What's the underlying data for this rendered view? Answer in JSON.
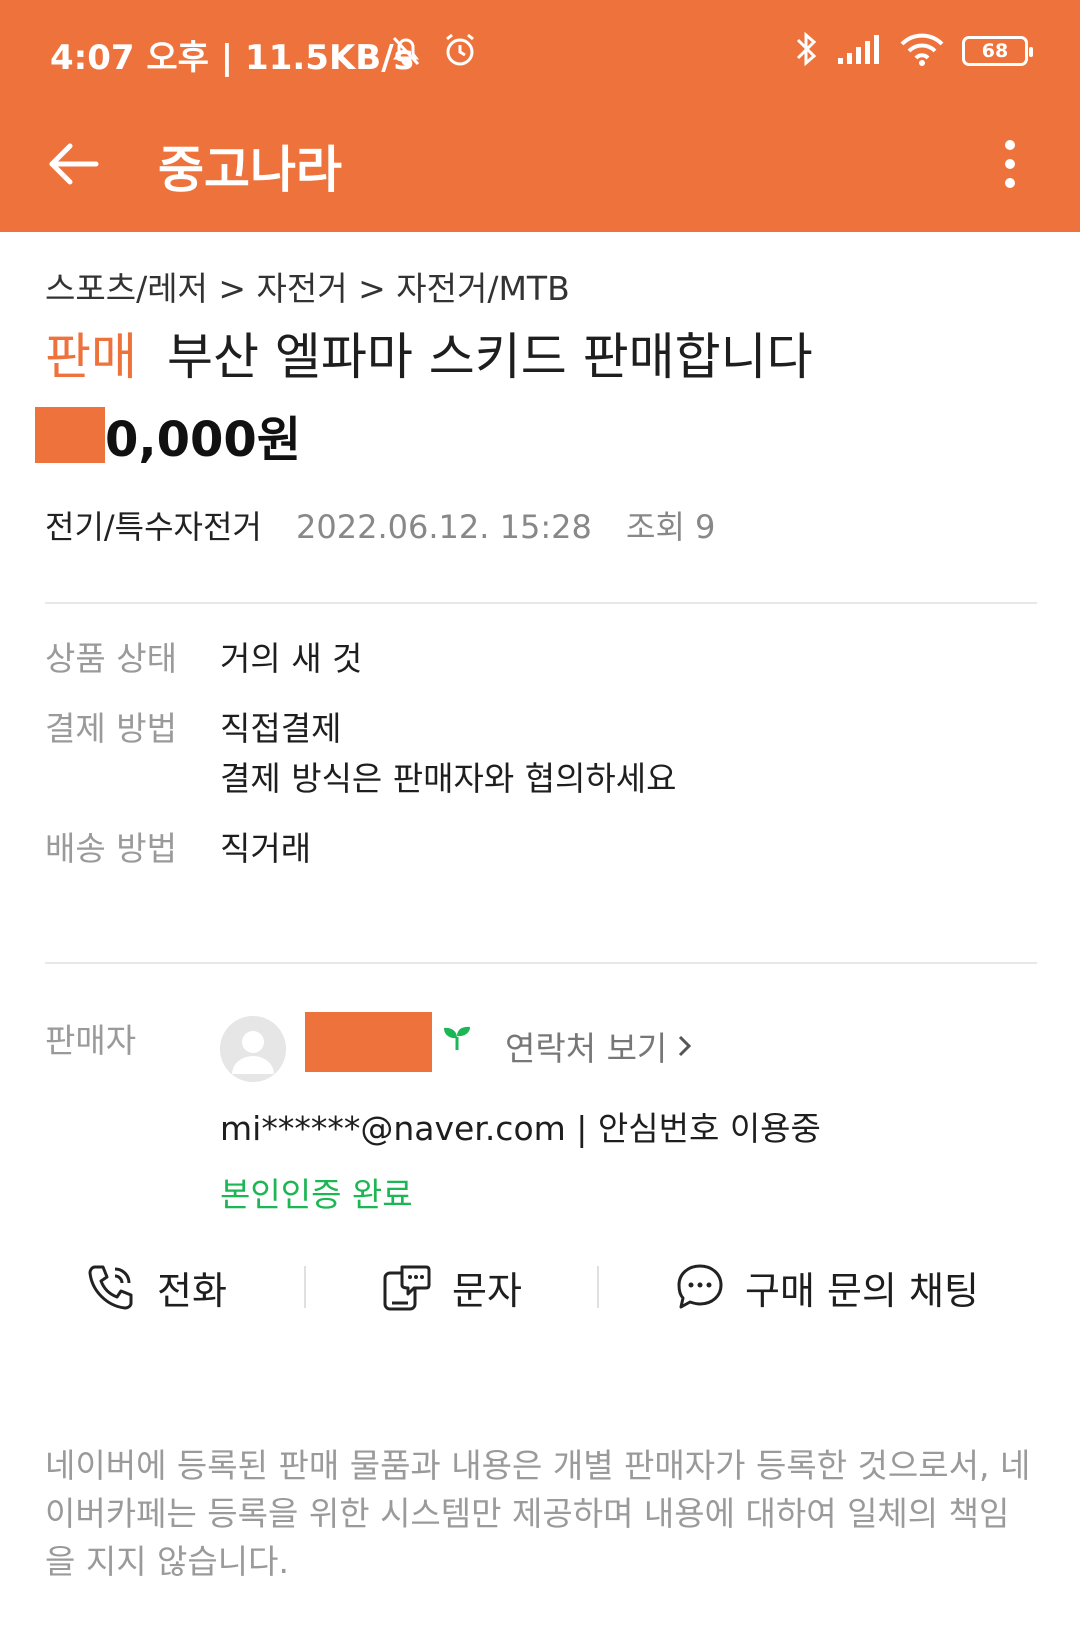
{
  "status_bar": {
    "time_text": "4:07 오후 | 11.5KB/s",
    "battery_level": "68",
    "icons": [
      "mute-icon",
      "alarm-icon",
      "bluetooth-icon",
      "signal-icon",
      "wifi-icon",
      "battery-icon"
    ]
  },
  "app_bar": {
    "title": "중고나라",
    "back_icon": "arrow-left-icon",
    "more_icon": "more-vertical-icon"
  },
  "post": {
    "breadcrumb": "스포츠/레저 > 자전거 > 자전거/MTB",
    "sale_tag": "판매",
    "title": "부산 엘파마 스키드 판매합니다",
    "price_text": "0,000원",
    "category": "전기/특수자전거",
    "date": "2022.06.12. 15:28",
    "views": "조회 9"
  },
  "details": {
    "condition_label": "상품 상태",
    "condition_value": "거의 새 것",
    "payment_label": "결제 방법",
    "payment_value": "직접결제",
    "payment_note": "결제 방식은 판매자와 협의하세요",
    "delivery_label": "배송 방법",
    "delivery_value": "직거래"
  },
  "seller": {
    "label": "판매자",
    "contact_link": "연락처 보기",
    "email_line": "mi******@naver.com | 안심번호 이용중",
    "verified": "본인인증 완료"
  },
  "actions": {
    "call": "전화",
    "sms": "문자",
    "chat": "구매 문의 채팅"
  },
  "disclaimer": "네이버에 등록된 판매 물품과 내용은 개별 판매자가 등록한 것으로서, 네이버카페는 등록을 위한 시스템만 제공하며 내용에 대하여 일체의 책임을 지지 않습니다.",
  "colors": {
    "brand": "#ee723b",
    "verified_green": "#1db654",
    "muted_text": "#9a9a9a"
  }
}
